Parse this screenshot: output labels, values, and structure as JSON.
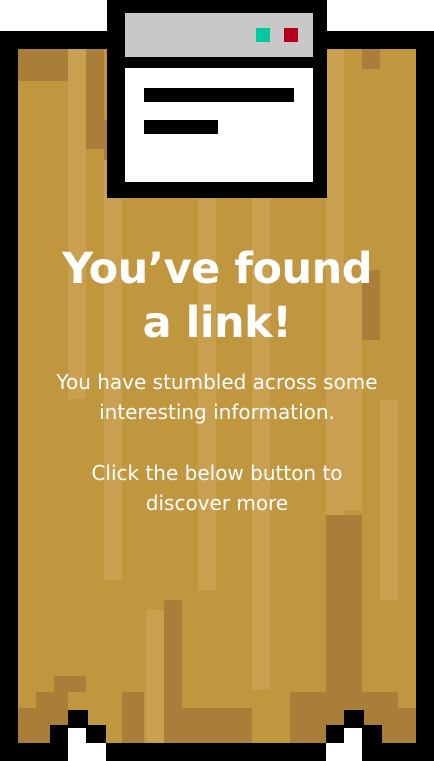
{
  "card": {
    "title_line_1": "You’ve found",
    "title_line_2": "a link!",
    "body_line_1": "You have stumbled across some",
    "body_line_2": "interesting information.",
    "body_line_3": "Click the below button to",
    "body_line_4": "discover more"
  },
  "window_icon": {
    "icon": "browser-window-icon",
    "button_colors": [
      "#00c8a0",
      "#b4001e"
    ]
  },
  "colors": {
    "wood_base": "#c0963f",
    "wood_light": "#c9a050",
    "wood_dark": "#a87e38",
    "outline": "#000000",
    "text": "#ffffff"
  }
}
